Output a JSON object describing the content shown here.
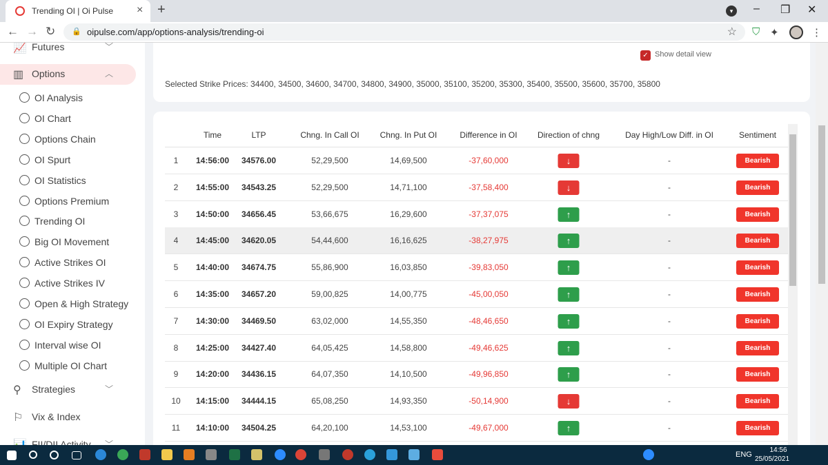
{
  "browser": {
    "tab_title": "Trending OI | Oi Pulse",
    "url": "oipulse.com/app/options-analysis/trending-oi"
  },
  "sidebar": {
    "main_items": [
      {
        "label": "Futures"
      },
      {
        "label": "Options"
      },
      {
        "label": "Strategies"
      },
      {
        "label": "Vix & Index"
      },
      {
        "label": "FII/DII Activity"
      }
    ],
    "option_items": [
      "OI Analysis",
      "OI Chart",
      "Options Chain",
      "OI Spurt",
      "OI Statistics",
      "Options Premium",
      "Trending OI",
      "Big OI Movement",
      "Active Strikes OI",
      "Active Strikes IV",
      "Open & High Strategy",
      "OI Expiry Strategy",
      "Interval wise OI",
      "Multiple OI Chart"
    ]
  },
  "filters": {
    "show_detail_label": "Show detail view",
    "show_detail_checked": true,
    "selected_strikes": "Selected Strike Prices: 34400, 34500, 34600, 34700, 34800, 34900, 35000, 35100, 35200, 35300, 35400, 35500, 35600, 35700, 35800"
  },
  "table": {
    "columns": [
      "Time",
      "LTP",
      "Chng. In Call OI",
      "Chng. In Put OI",
      "Difference in OI",
      "Direction of chng",
      "Day High/Low Diff. in OI",
      "Sentiment"
    ],
    "rows": [
      {
        "n": "1",
        "time": "14:56:00",
        "ltp": "34576.00",
        "call": "52,29,500",
        "put": "14,69,500",
        "diff": "-37,60,000",
        "dir": "down",
        "hl": "-",
        "sentiment": "Bearish"
      },
      {
        "n": "2",
        "time": "14:55:00",
        "ltp": "34543.25",
        "call": "52,29,500",
        "put": "14,71,100",
        "diff": "-37,58,400",
        "dir": "down",
        "hl": "-",
        "sentiment": "Bearish"
      },
      {
        "n": "3",
        "time": "14:50:00",
        "ltp": "34656.45",
        "call": "53,66,675",
        "put": "16,29,600",
        "diff": "-37,37,075",
        "dir": "up",
        "hl": "-",
        "sentiment": "Bearish"
      },
      {
        "n": "4",
        "time": "14:45:00",
        "ltp": "34620.05",
        "call": "54,44,600",
        "put": "16,16,625",
        "diff": "-38,27,975",
        "dir": "up",
        "hl": "-",
        "sentiment": "Bearish"
      },
      {
        "n": "5",
        "time": "14:40:00",
        "ltp": "34674.75",
        "call": "55,86,900",
        "put": "16,03,850",
        "diff": "-39,83,050",
        "dir": "up",
        "hl": "-",
        "sentiment": "Bearish"
      },
      {
        "n": "6",
        "time": "14:35:00",
        "ltp": "34657.20",
        "call": "59,00,825",
        "put": "14,00,775",
        "diff": "-45,00,050",
        "dir": "up",
        "hl": "-",
        "sentiment": "Bearish"
      },
      {
        "n": "7",
        "time": "14:30:00",
        "ltp": "34469.50",
        "call": "63,02,000",
        "put": "14,55,350",
        "diff": "-48,46,650",
        "dir": "up",
        "hl": "-",
        "sentiment": "Bearish"
      },
      {
        "n": "8",
        "time": "14:25:00",
        "ltp": "34427.40",
        "call": "64,05,425",
        "put": "14,58,800",
        "diff": "-49,46,625",
        "dir": "up",
        "hl": "-",
        "sentiment": "Bearish"
      },
      {
        "n": "9",
        "time": "14:20:00",
        "ltp": "34436.15",
        "call": "64,07,350",
        "put": "14,10,500",
        "diff": "-49,96,850",
        "dir": "up",
        "hl": "-",
        "sentiment": "Bearish"
      },
      {
        "n": "10",
        "time": "14:15:00",
        "ltp": "34444.15",
        "call": "65,08,250",
        "put": "14,93,350",
        "diff": "-50,14,900",
        "dir": "down",
        "hl": "-",
        "sentiment": "Bearish"
      },
      {
        "n": "11",
        "time": "14:10:00",
        "ltp": "34504.25",
        "call": "64,20,100",
        "put": "14,53,100",
        "diff": "-49,67,000",
        "dir": "up",
        "hl": "-",
        "sentiment": "Bearish"
      }
    ]
  },
  "taskbar": {
    "lang": "ENG",
    "time": "14:56",
    "date": "25/05/2021"
  },
  "colors": {
    "bearish": "#f0352b",
    "up": "#2e9e4b",
    "down": "#e53935",
    "accent_bg": "#fde7e7"
  }
}
